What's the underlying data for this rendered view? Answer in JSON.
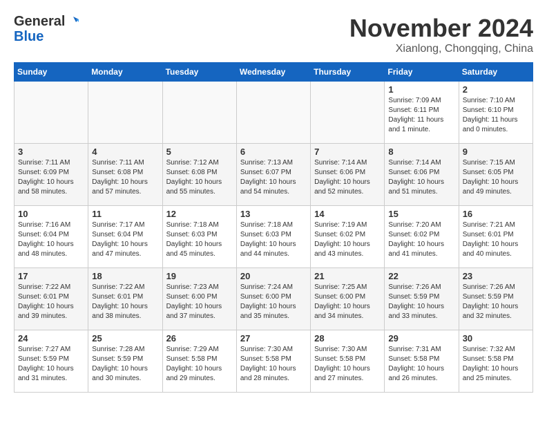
{
  "header": {
    "logo_line1": "General",
    "logo_line2": "Blue",
    "month_title": "November 2024",
    "location": "Xianlong, Chongqing, China"
  },
  "calendar": {
    "weekdays": [
      "Sunday",
      "Monday",
      "Tuesday",
      "Wednesday",
      "Thursday",
      "Friday",
      "Saturday"
    ],
    "weeks": [
      [
        {
          "day": "",
          "info": ""
        },
        {
          "day": "",
          "info": ""
        },
        {
          "day": "",
          "info": ""
        },
        {
          "day": "",
          "info": ""
        },
        {
          "day": "",
          "info": ""
        },
        {
          "day": "1",
          "info": "Sunrise: 7:09 AM\nSunset: 6:11 PM\nDaylight: 11 hours\nand 1 minute."
        },
        {
          "day": "2",
          "info": "Sunrise: 7:10 AM\nSunset: 6:10 PM\nDaylight: 11 hours\nand 0 minutes."
        }
      ],
      [
        {
          "day": "3",
          "info": "Sunrise: 7:11 AM\nSunset: 6:09 PM\nDaylight: 10 hours\nand 58 minutes."
        },
        {
          "day": "4",
          "info": "Sunrise: 7:11 AM\nSunset: 6:08 PM\nDaylight: 10 hours\nand 57 minutes."
        },
        {
          "day": "5",
          "info": "Sunrise: 7:12 AM\nSunset: 6:08 PM\nDaylight: 10 hours\nand 55 minutes."
        },
        {
          "day": "6",
          "info": "Sunrise: 7:13 AM\nSunset: 6:07 PM\nDaylight: 10 hours\nand 54 minutes."
        },
        {
          "day": "7",
          "info": "Sunrise: 7:14 AM\nSunset: 6:06 PM\nDaylight: 10 hours\nand 52 minutes."
        },
        {
          "day": "8",
          "info": "Sunrise: 7:14 AM\nSunset: 6:06 PM\nDaylight: 10 hours\nand 51 minutes."
        },
        {
          "day": "9",
          "info": "Sunrise: 7:15 AM\nSunset: 6:05 PM\nDaylight: 10 hours\nand 49 minutes."
        }
      ],
      [
        {
          "day": "10",
          "info": "Sunrise: 7:16 AM\nSunset: 6:04 PM\nDaylight: 10 hours\nand 48 minutes."
        },
        {
          "day": "11",
          "info": "Sunrise: 7:17 AM\nSunset: 6:04 PM\nDaylight: 10 hours\nand 47 minutes."
        },
        {
          "day": "12",
          "info": "Sunrise: 7:18 AM\nSunset: 6:03 PM\nDaylight: 10 hours\nand 45 minutes."
        },
        {
          "day": "13",
          "info": "Sunrise: 7:18 AM\nSunset: 6:03 PM\nDaylight: 10 hours\nand 44 minutes."
        },
        {
          "day": "14",
          "info": "Sunrise: 7:19 AM\nSunset: 6:02 PM\nDaylight: 10 hours\nand 43 minutes."
        },
        {
          "day": "15",
          "info": "Sunrise: 7:20 AM\nSunset: 6:02 PM\nDaylight: 10 hours\nand 41 minutes."
        },
        {
          "day": "16",
          "info": "Sunrise: 7:21 AM\nSunset: 6:01 PM\nDaylight: 10 hours\nand 40 minutes."
        }
      ],
      [
        {
          "day": "17",
          "info": "Sunrise: 7:22 AM\nSunset: 6:01 PM\nDaylight: 10 hours\nand 39 minutes."
        },
        {
          "day": "18",
          "info": "Sunrise: 7:22 AM\nSunset: 6:01 PM\nDaylight: 10 hours\nand 38 minutes."
        },
        {
          "day": "19",
          "info": "Sunrise: 7:23 AM\nSunset: 6:00 PM\nDaylight: 10 hours\nand 37 minutes."
        },
        {
          "day": "20",
          "info": "Sunrise: 7:24 AM\nSunset: 6:00 PM\nDaylight: 10 hours\nand 35 minutes."
        },
        {
          "day": "21",
          "info": "Sunrise: 7:25 AM\nSunset: 6:00 PM\nDaylight: 10 hours\nand 34 minutes."
        },
        {
          "day": "22",
          "info": "Sunrise: 7:26 AM\nSunset: 5:59 PM\nDaylight: 10 hours\nand 33 minutes."
        },
        {
          "day": "23",
          "info": "Sunrise: 7:26 AM\nSunset: 5:59 PM\nDaylight: 10 hours\nand 32 minutes."
        }
      ],
      [
        {
          "day": "24",
          "info": "Sunrise: 7:27 AM\nSunset: 5:59 PM\nDaylight: 10 hours\nand 31 minutes."
        },
        {
          "day": "25",
          "info": "Sunrise: 7:28 AM\nSunset: 5:59 PM\nDaylight: 10 hours\nand 30 minutes."
        },
        {
          "day": "26",
          "info": "Sunrise: 7:29 AM\nSunset: 5:58 PM\nDaylight: 10 hours\nand 29 minutes."
        },
        {
          "day": "27",
          "info": "Sunrise: 7:30 AM\nSunset: 5:58 PM\nDaylight: 10 hours\nand 28 minutes."
        },
        {
          "day": "28",
          "info": "Sunrise: 7:30 AM\nSunset: 5:58 PM\nDaylight: 10 hours\nand 27 minutes."
        },
        {
          "day": "29",
          "info": "Sunrise: 7:31 AM\nSunset: 5:58 PM\nDaylight: 10 hours\nand 26 minutes."
        },
        {
          "day": "30",
          "info": "Sunrise: 7:32 AM\nSunset: 5:58 PM\nDaylight: 10 hours\nand 25 minutes."
        }
      ]
    ]
  }
}
